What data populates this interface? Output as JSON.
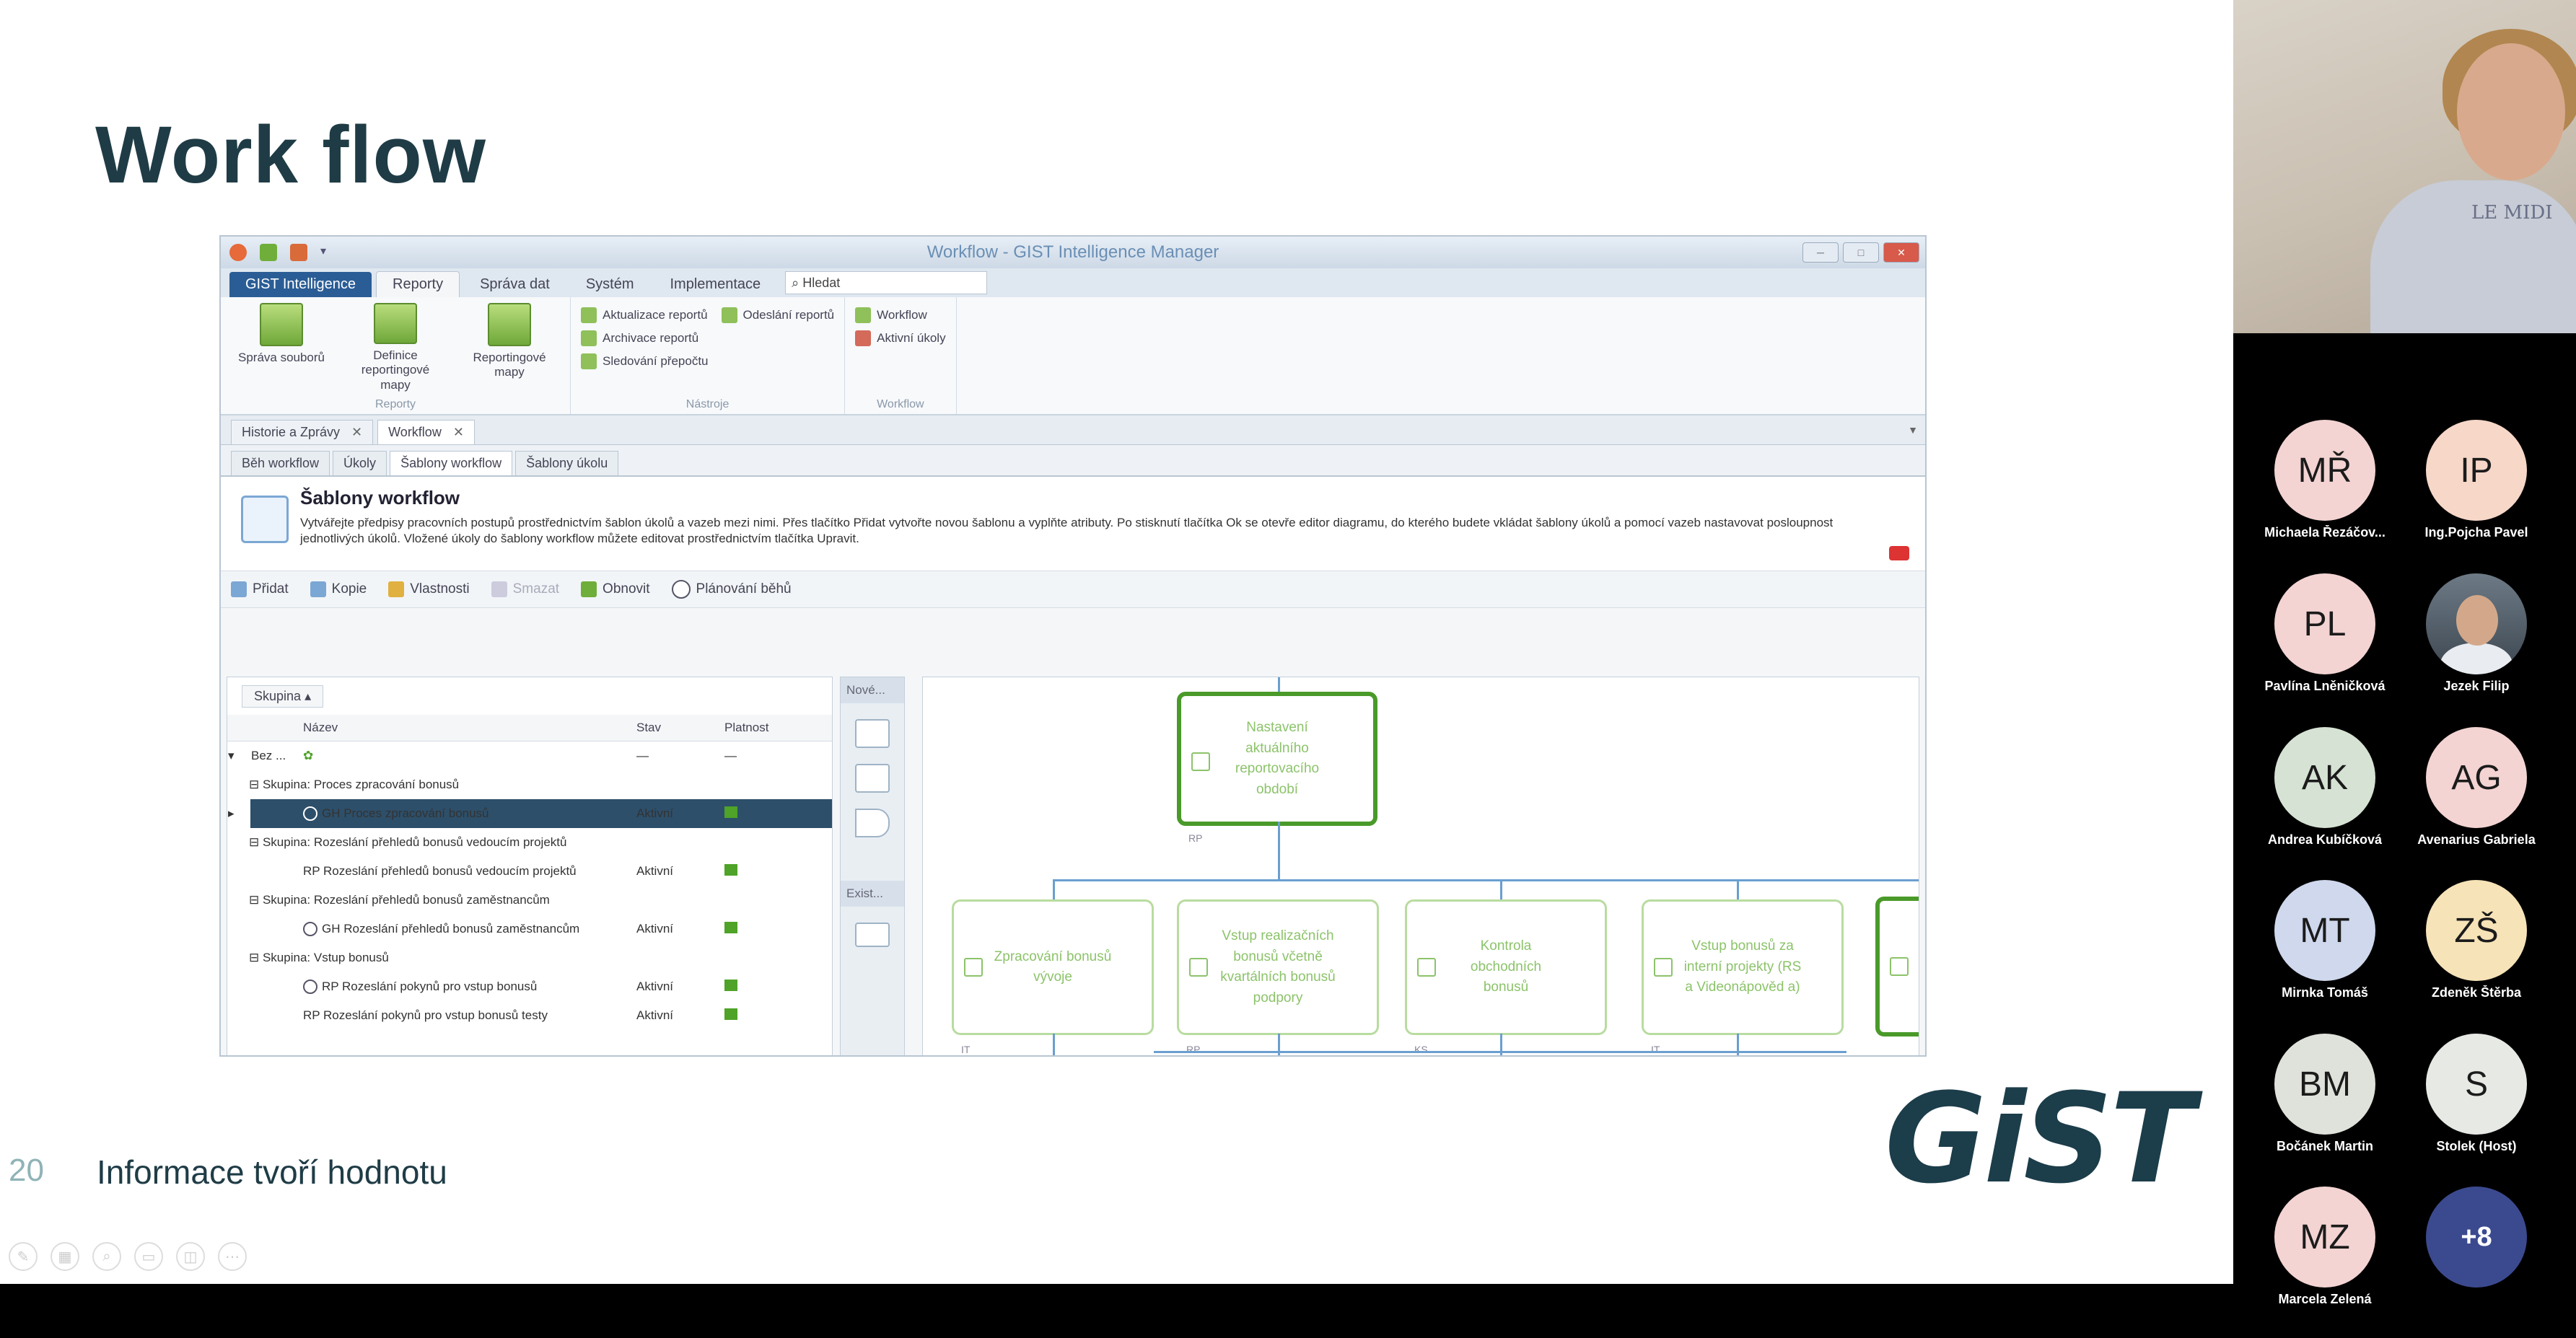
{
  "slide": {
    "title": "Work flow",
    "number": "20",
    "footer": "Informace tvoří hodnotu",
    "logo": "GiST"
  },
  "app": {
    "window_title": "Workflow - GIST Intelligence Manager",
    "menu": {
      "app_tab": "GIST Intelligence",
      "tabs": [
        "Reporty",
        "Správa dat",
        "Systém",
        "Implementace"
      ],
      "search": "Hledat"
    },
    "ribbon": {
      "reporty_group": {
        "label": "Reporty",
        "buttons": [
          "Správa souborů",
          "Definice reportingové mapy",
          "Reportingové mapy"
        ]
      },
      "nastroje_group": {
        "label": "Nástroje",
        "buttons": [
          "Aktualizace reportů",
          "Archivace reportů",
          "Sledování přepočtu",
          "Odeslání reportů"
        ]
      },
      "workflow_group": {
        "label": "Workflow",
        "buttons": [
          "Workflow",
          "Aktivní úkoly"
        ]
      }
    },
    "doc_tabs": [
      "Historie a Zprávy",
      "Workflow"
    ],
    "sub_tabs": [
      "Běh workflow",
      "Úkoly",
      "Šablony workflow",
      "Šablony úkolu"
    ],
    "info": {
      "title": "Šablony workflow",
      "description": "Vytvářejte předpisy pracovních postupů prostřednictvím šablon úkolů a vazeb mezi nimi. Přes tlačítko Přidat vytvořte novou šablonu a vyplňte atributy. Po stisknutí tlačítka Ok se otevře editor diagramu, do kterého budete vkládat šablony úkolů a pomocí vazeb nastavovat posloupnost jednotlivých úkolů. Vložené úkoly do šablony workflow můžete editovat prostřednictvím tlačítka Upravit."
    },
    "toolbar": [
      "Přidat",
      "Kopie",
      "Vlastnosti",
      "Smazat",
      "Obnovit",
      "Plánování běhů"
    ],
    "grid": {
      "group_chip": "Skupina",
      "columns": [
        "Název",
        "Stav",
        "Platnost"
      ],
      "root": {
        "name": "Bez ...",
        "stav": "—",
        "platnost": "—"
      },
      "rows": [
        {
          "type": "group",
          "name": "Skupina: Proces zpracování bonusů"
        },
        {
          "type": "row",
          "name": "GH Proces zpracování bonusů",
          "stav": "Aktivní",
          "selected": true
        },
        {
          "type": "group",
          "name": "Skupina: Rozeslání přehledů bonusů vedoucím projektů"
        },
        {
          "type": "row",
          "name": "RP Rozeslání přehledů bonusů vedoucím projektů",
          "stav": "Aktivní"
        },
        {
          "type": "group",
          "name": "Skupina: Rozeslání přehledů bonusů zaměstnancům"
        },
        {
          "type": "row",
          "name": "GH Rozeslání přehledů bonusů zaměstnancům",
          "stav": "Aktivní"
        },
        {
          "type": "group",
          "name": "Skupina: Vstup bonusů"
        },
        {
          "type": "row",
          "name": "RP Rozeslání pokynů pro vstup bonusů",
          "stav": "Aktivní"
        },
        {
          "type": "row",
          "name": "RP Rozeslání pokynů pro vstup bonusů testy",
          "stav": "Aktivní"
        }
      ]
    },
    "palette": {
      "new_label": "Nové...",
      "exist_label": "Exist..."
    },
    "diagram": {
      "nodes": [
        {
          "label": "Nastavení aktuálního reportovacího období",
          "tag": "RP"
        },
        {
          "label": "Zpracování bonusů vývoje",
          "tag": "IT"
        },
        {
          "label": "Vstup realizačních bonusů včetně kvartálních bonusů podpory",
          "tag": "RP"
        },
        {
          "label": "Kontrola obchodních bonusů",
          "tag": "KS"
        },
        {
          "label": "Vstup bonusů za interní projekty (RS a Videonápověd a)",
          "tag": "IT"
        }
      ]
    }
  },
  "call": {
    "participants": [
      {
        "initials": "MŘ",
        "name": "Michaela Řezáčov...",
        "color": "#f3d4d2"
      },
      {
        "initials": "IP",
        "name": "Ing.Pojcha Pavel",
        "color": "#f6d7c8"
      },
      {
        "initials": "PL",
        "name": "Pavlína Lněničková",
        "color": "#f3d4d2"
      },
      {
        "initials": "",
        "name": "Jezek Filip",
        "color": ""
      },
      {
        "initials": "AK",
        "name": "Andrea Kubíčková",
        "color": "#d6e3d4"
      },
      {
        "initials": "AG",
        "name": "Avenarius Gabriela",
        "color": "#f3d4d2"
      },
      {
        "initials": "MT",
        "name": "Mirnka Tomáš",
        "color": "#cfd8ec"
      },
      {
        "initials": "ZŠ",
        "name": "Zdeněk Štěrba",
        "color": "#f6e3b8"
      },
      {
        "initials": "BM",
        "name": "Bočánek Martin",
        "color": "#dfe2da"
      },
      {
        "initials": "S",
        "name": "Stolek (Host)",
        "color": "#e6e9e4"
      },
      {
        "initials": "MZ",
        "name": "Marcela Zelená",
        "color": "#f3d4d2"
      },
      {
        "initials": "+8",
        "name": "",
        "color": "#3b4a8f"
      }
    ],
    "shirt_text": "LE MIDI"
  }
}
